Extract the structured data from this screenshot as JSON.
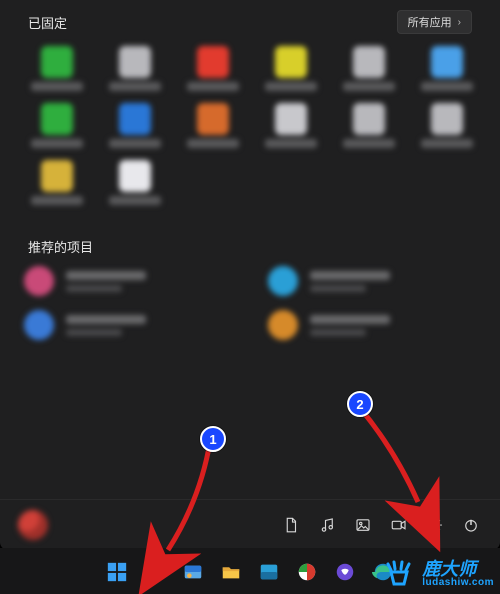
{
  "start_menu": {
    "pinned_title": "已固定",
    "all_apps_label": "所有应用",
    "recommended_title": "推荐的项目",
    "power_icons": [
      "document",
      "music",
      "photos",
      "video",
      "settings",
      "power"
    ]
  },
  "pinned_colors": [
    "#2fae3e",
    "#b8b8bc",
    "#e23b2e",
    "#d8cf2a",
    "#b8b8bc",
    "#4aa0e8",
    "#2fae3e",
    "#2a77d6",
    "#d66a2c",
    "#c8c8cc",
    "#b8b8bc",
    "#b8b8bc",
    "#d6b23a",
    "#e8e8ec"
  ],
  "recommended_colors": [
    "#c94a78",
    "#2a9fd6",
    "#3a7ad6",
    "#d68a2a"
  ],
  "callouts": {
    "one": "1",
    "two": "2"
  },
  "watermark": "鹿大师",
  "watermark_url": "ludashiw.com",
  "taskbar_items": [
    "start",
    "search",
    "taskview",
    "explorer",
    "store",
    "widget",
    "chat",
    "edge"
  ]
}
